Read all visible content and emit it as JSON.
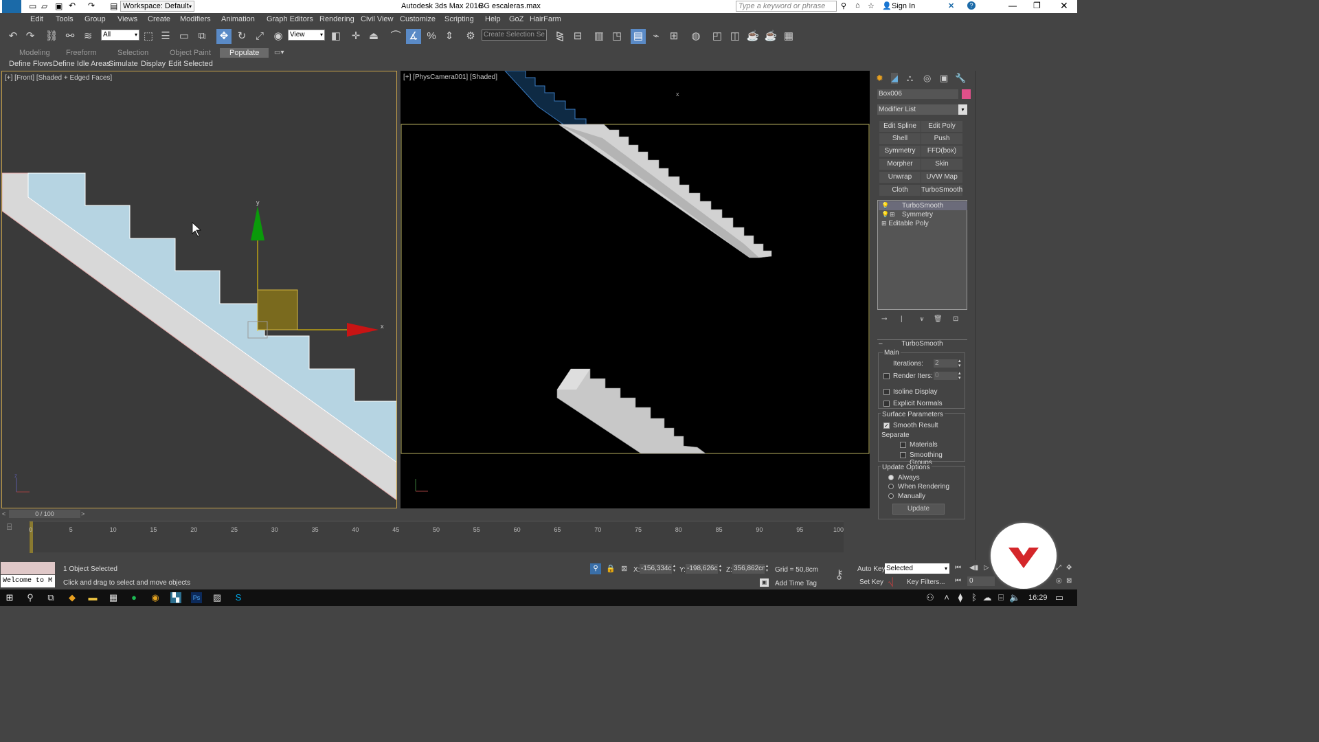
{
  "title": {
    "app": "Autodesk 3ds Max 2016",
    "file": "BG escaleras.max",
    "workspace": "Workspace: Default",
    "search_placeholder": "Type a keyword or phrase",
    "sign_in": "Sign In"
  },
  "menu": [
    "Edit",
    "Tools",
    "Group",
    "Views",
    "Create",
    "Modifiers",
    "Animation",
    "Graph Editors",
    "Rendering",
    "Civil View",
    "Customize",
    "Scripting",
    "Help",
    "GoZ",
    "HairFarm"
  ],
  "toolbar": {
    "filter": "All",
    "coord": "View",
    "selection_set_placeholder": "Create Selection Se"
  },
  "ribbon": {
    "tabs": [
      "Modeling",
      "Freeform",
      "Selection",
      "Object Paint",
      "Populate"
    ],
    "subtools": [
      "Define Flows",
      "Define Idle Areas",
      "Simulate",
      "Display",
      "Edit Selected"
    ]
  },
  "viewports": {
    "front": "[+] [Front] [Shaded + Edged Faces]",
    "camera": "[+] [PhysCamera001] [Shaded]",
    "axis_x": "x",
    "axis_y": "y",
    "axis_z": "z"
  },
  "command_panel": {
    "object_name": "Box006",
    "modifier_list": "Modifier List",
    "buttons": [
      "Edit Spline",
      "Edit Poly",
      "Shell",
      "Push",
      "Symmetry",
      "FFD(box)",
      "Morpher",
      "Skin",
      "Unwrap UVW",
      "UVW Map",
      "Cloth",
      "TurboSmooth"
    ],
    "stack": [
      "TurboSmooth",
      "Symmetry",
      "Editable Poly"
    ],
    "rollout_title": "TurboSmooth",
    "main_label": "Main",
    "iterations_label": "Iterations:",
    "iterations_value": "2",
    "render_iters_label": "Render Iters:",
    "render_iters_value": "0",
    "isoline": "Isoline Display",
    "explicit_normals": "Explicit Normals",
    "surface_params": "Surface Parameters",
    "smooth_result": "Smooth Result",
    "separate": "Separate",
    "materials": "Materials",
    "smoothing_groups": "Smoothing Groups",
    "update_options": "Update Options",
    "always": "Always",
    "when_rendering": "When Rendering",
    "manually": "Manually",
    "update_btn": "Update"
  },
  "timeline": {
    "frame_display": "0 / 100",
    "ticks": [
      "0",
      "5",
      "10",
      "15",
      "20",
      "25",
      "30",
      "35",
      "40",
      "45",
      "50",
      "55",
      "60",
      "65",
      "70",
      "75",
      "80",
      "85",
      "90",
      "95",
      "100"
    ]
  },
  "status": {
    "script_listener": "Welcome to M",
    "selected": "1 Object Selected",
    "prompt": "Click and drag to select and move objects",
    "x_label": "X:",
    "x_value": "-156,334cı",
    "y_label": "Y:",
    "y_value": "-198,626cı",
    "z_label": "Z:",
    "z_value": "356,862cm",
    "grid": "Grid = 50,8cm",
    "add_time_tag": "Add Time Tag",
    "auto_key": "Auto Key",
    "set_key": "Set Key",
    "key_mode": "Selected",
    "key_filters": "Key Filters...",
    "frame": "0"
  },
  "taskbar": {
    "time": "16:29"
  }
}
